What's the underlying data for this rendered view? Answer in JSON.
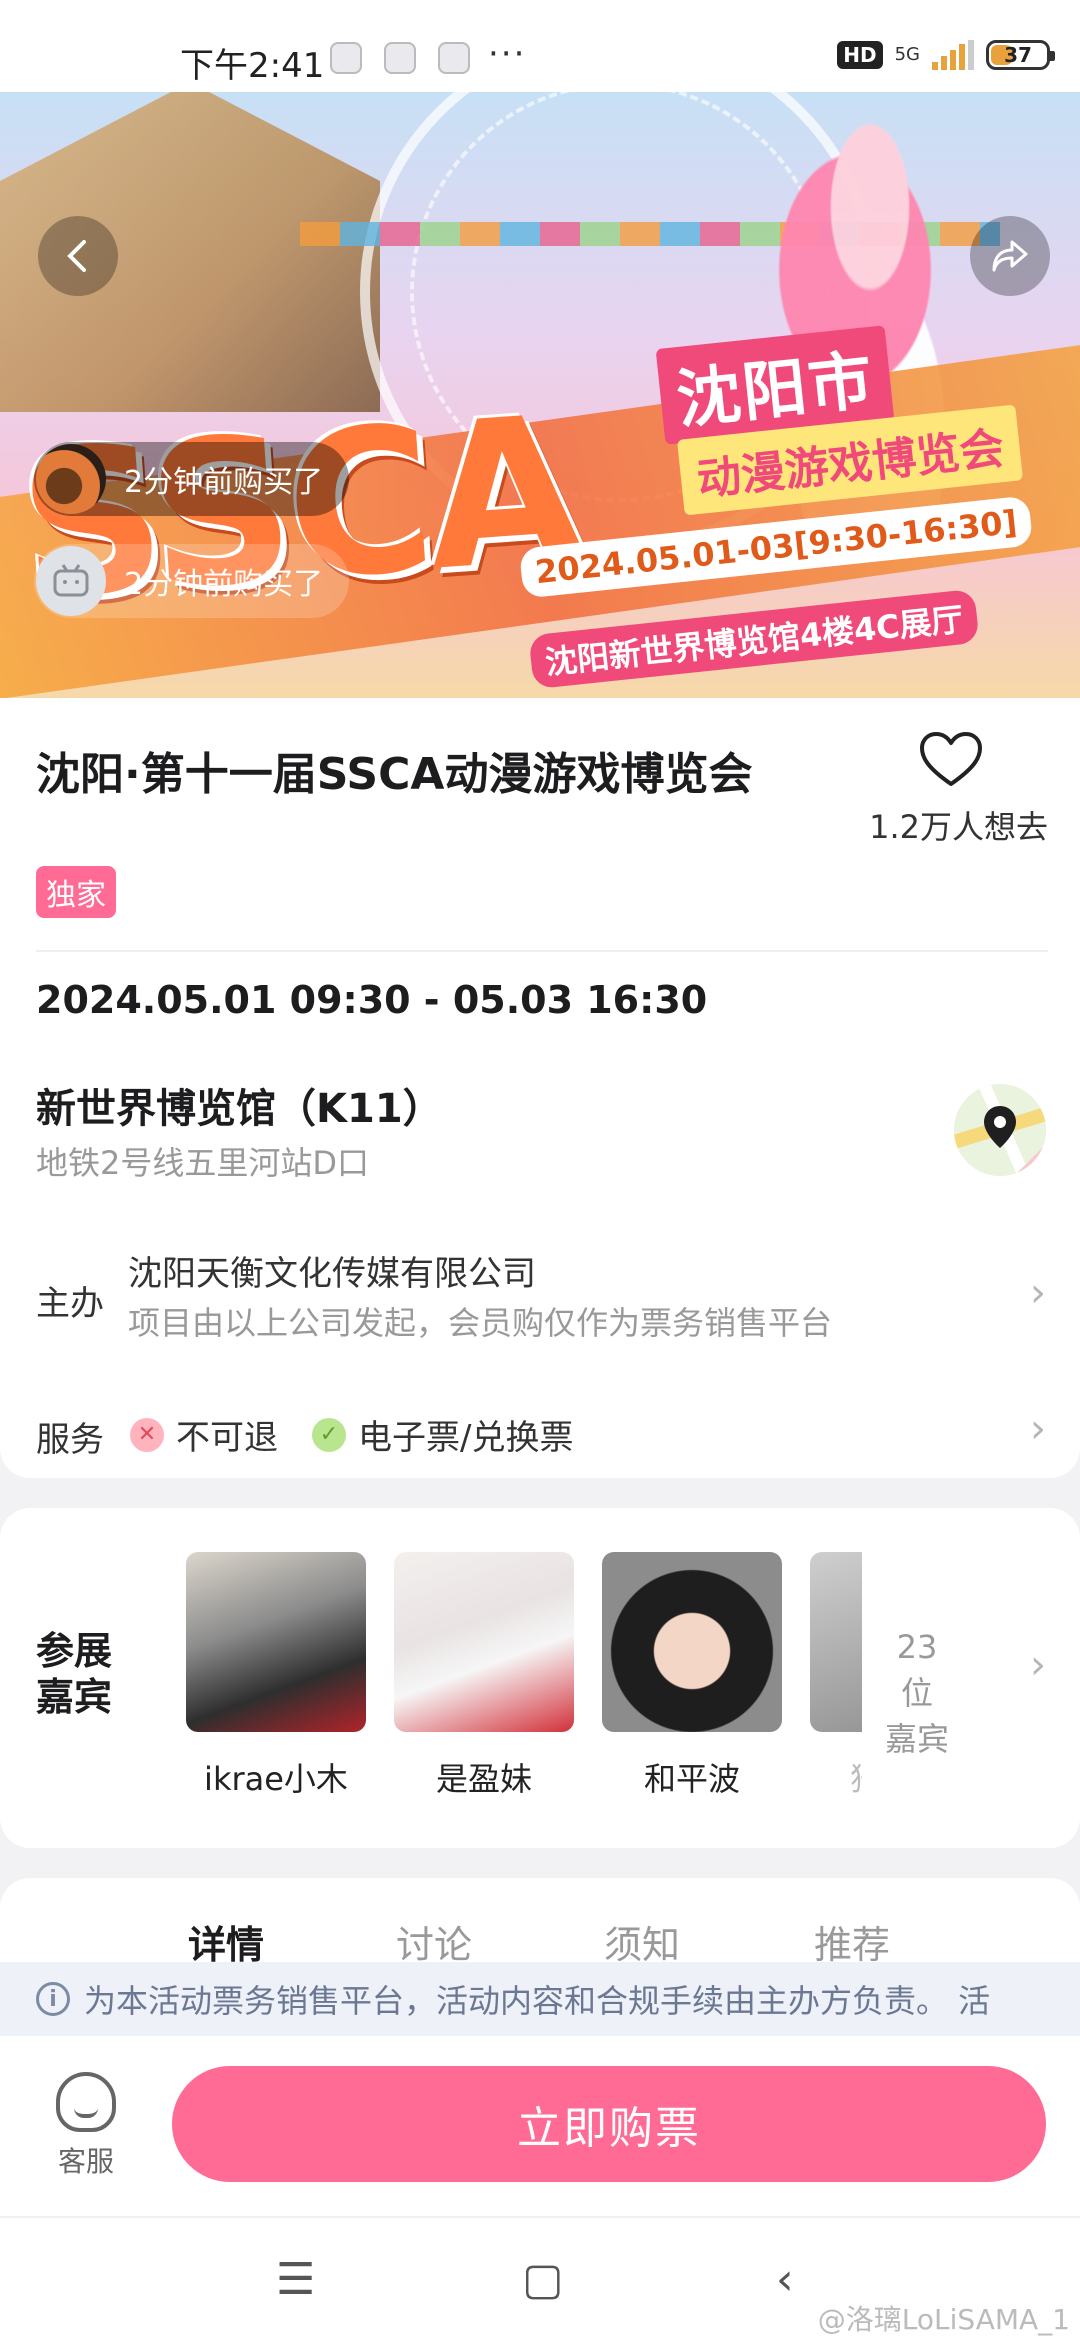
{
  "status_bar": {
    "time": "下午2:41",
    "more": "···",
    "hd": "HD",
    "network": "5G",
    "battery": "37"
  },
  "hero": {
    "back_icon": "back-arrow-icon",
    "share_icon": "share-icon",
    "logo_text": "SSCA",
    "city": "沈阳市",
    "expo_name": "动漫游戏博览会",
    "date_range": "2024.05.01-03[9:30-16:30]",
    "venue": "沈阳新世界博览馆4楼4C展厅",
    "tickers": [
      {
        "text": "2分钟前购买了"
      },
      {
        "text": "2分钟前购买了"
      }
    ]
  },
  "event": {
    "title": "沈阳·第十一届SSCA动漫游戏博览会",
    "want_count": "1.2万人想去",
    "badge": "独家",
    "datetime": "2024.05.01 09:30 - 05.03 16:30",
    "venue_name": "新世界博览馆（K11）",
    "venue_transit": "地铁2号线五里河站D口",
    "organizer_label": "主办",
    "organizer_name": "沈阳天衡文化传媒有限公司",
    "organizer_note": "项目由以上公司发起，会员购仅作为票务销售平台",
    "service_label": "服务",
    "services": [
      {
        "label": "不可退",
        "ok": false
      },
      {
        "label": "电子票/兑换票",
        "ok": true
      }
    ]
  },
  "guests": {
    "title": "参展嘉宾",
    "items": [
      {
        "name": "ikrae小木"
      },
      {
        "name": "是盈妹"
      },
      {
        "name": "和平波"
      },
      {
        "name": "猗"
      }
    ],
    "count_label": "23位 嘉宾"
  },
  "tabs": [
    "详情",
    "讨论",
    "须知",
    "推荐"
  ],
  "notice": "为本活动票务销售平台，活动内容和合规手续由主办方负责。 活",
  "bottom": {
    "cs_label": "客服",
    "buy_label": "立即购票"
  },
  "nav": {
    "menu": "☰",
    "home": "▢",
    "back": "‹"
  },
  "watermark": "@洛璃LoLiSAMA_1"
}
